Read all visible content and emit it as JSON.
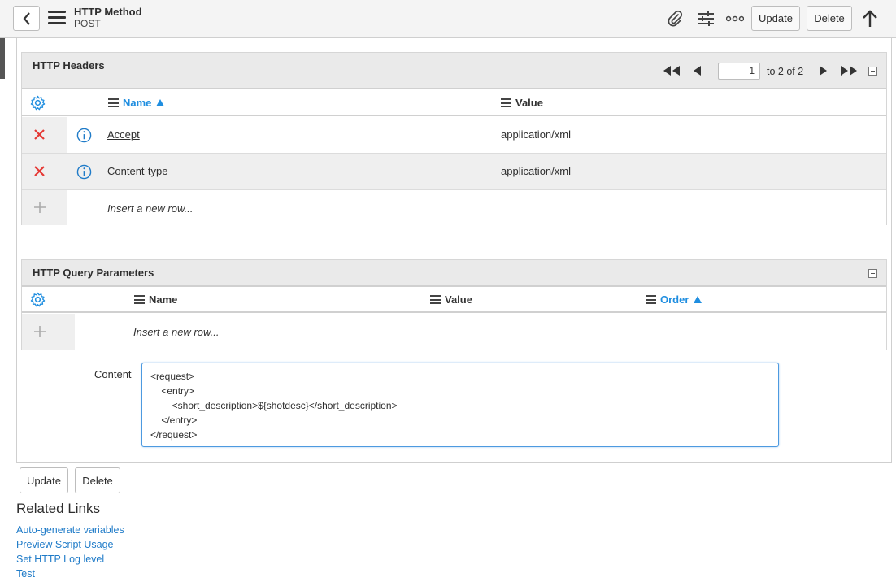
{
  "header": {
    "title": "HTTP Method",
    "subtitle": "POST",
    "update_label": "Update",
    "delete_label": "Delete",
    "icons": [
      "chevron-left-icon",
      "hamburger-menu-icon",
      "paperclip-icon",
      "sliders-icon",
      "more-options-icon",
      "arrow-up-icon"
    ]
  },
  "http_headers": {
    "title": "HTTP Headers",
    "pager": {
      "current_page": "1",
      "range_text": "to 2 of 2"
    },
    "columns": {
      "name": "Name",
      "value": "Value"
    },
    "rows": [
      {
        "name": "Accept",
        "value": "application/xml"
      },
      {
        "name": "Content-type",
        "value": "application/xml"
      }
    ],
    "insert_row": "Insert a new row..."
  },
  "query_params": {
    "title": "HTTP Query Parameters",
    "columns": {
      "name": "Name",
      "value": "Value",
      "order": "Order"
    },
    "insert_row": "Insert a new row..."
  },
  "content": {
    "label": "Content",
    "value": "<request>\n    <entry>\n        <short_description>${shotdesc}</short_description>\n    </entry>\n</request>"
  },
  "form_buttons": {
    "update": "Update",
    "delete": "Delete"
  },
  "related_links": {
    "title": "Related Links",
    "links": [
      "Auto-generate variables",
      "Preview Script Usage",
      "Set HTTP Log level",
      "Test"
    ]
  },
  "colors": {
    "accent": "#1f8ee0",
    "delete_red": "#e53935",
    "link_blue": "#1f7bc8"
  }
}
